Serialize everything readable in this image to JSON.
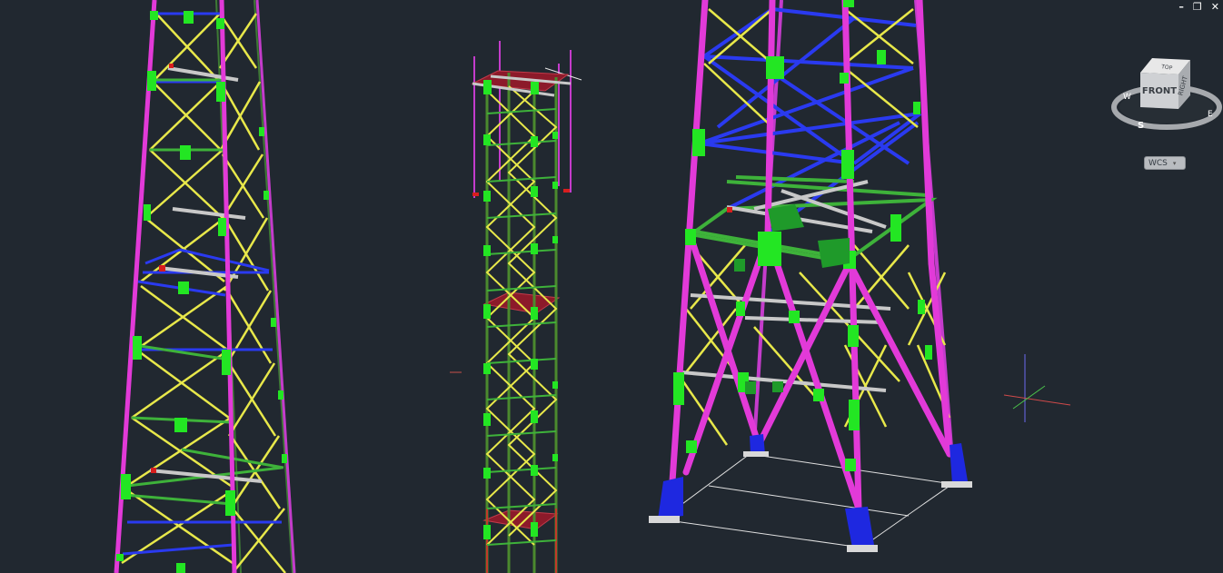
{
  "window_controls": {
    "minimize": "–",
    "restore": "❐",
    "close": "✕"
  },
  "viewcube": {
    "face": "FRONT",
    "side": "RIGHT",
    "top": "TOP",
    "compass": {
      "west": "W",
      "south": "S",
      "east": "E"
    }
  },
  "wcs": {
    "label": "WCS",
    "caret": "▾"
  },
  "colors": {
    "background": "#212830",
    "leg_magenta": "#e23ad8",
    "brace_yellow": "#e8e84a",
    "horizontal_blue": "#2a3af0",
    "plate_green": "#23e623",
    "frame_dark_green": "#4b8a2e",
    "platform_red": "#8c1a2a",
    "grate_grey": "#c8c8c8"
  }
}
